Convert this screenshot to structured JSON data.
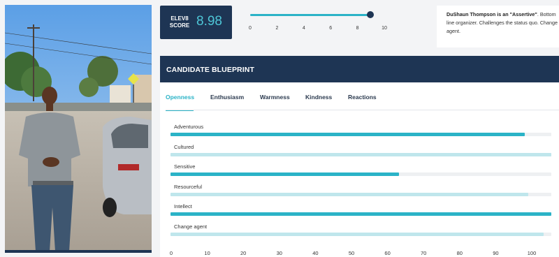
{
  "video": {
    "progress": 1.0
  },
  "score": {
    "label_line1": "ELEV8",
    "label_line2": "SCORE",
    "value": "8.98"
  },
  "slider": {
    "min": 0,
    "max": 10,
    "value": 8.98,
    "ticks": [
      "0",
      "2",
      "4",
      "6",
      "8",
      "10"
    ]
  },
  "description": {
    "name_bold": "DuShaun Thompson is an \"Assertive\"",
    "text": ". Bottom line organizer. Challenges the status quo. Change agent."
  },
  "blueprint": {
    "title": "CANDIDATE BLUEPRINT",
    "tabs": [
      {
        "label": "Openness",
        "active": true
      },
      {
        "label": "Enthusiasm",
        "active": false
      },
      {
        "label": "Warmness",
        "active": false
      },
      {
        "label": "Kindness",
        "active": false
      },
      {
        "label": "Reactions",
        "active": false
      }
    ],
    "traits": [
      {
        "label": "Adventurous",
        "value": 93,
        "style": "strong"
      },
      {
        "label": "Cultured",
        "value": 100,
        "style": "light"
      },
      {
        "label": "Sensitive",
        "value": 60,
        "style": "strong"
      },
      {
        "label": "Resourceful",
        "value": 94,
        "style": "light"
      },
      {
        "label": "Intellect",
        "value": 100,
        "style": "strong"
      },
      {
        "label": "Change agent",
        "value": 98,
        "style": "light"
      }
    ],
    "axis_ticks": [
      "0",
      "10",
      "20",
      "30",
      "40",
      "50",
      "60",
      "70",
      "80",
      "90",
      "100"
    ]
  },
  "colors": {
    "navy": "#1e3554",
    "teal": "#2bb3c7",
    "teal_light": "#bfe6ec"
  }
}
